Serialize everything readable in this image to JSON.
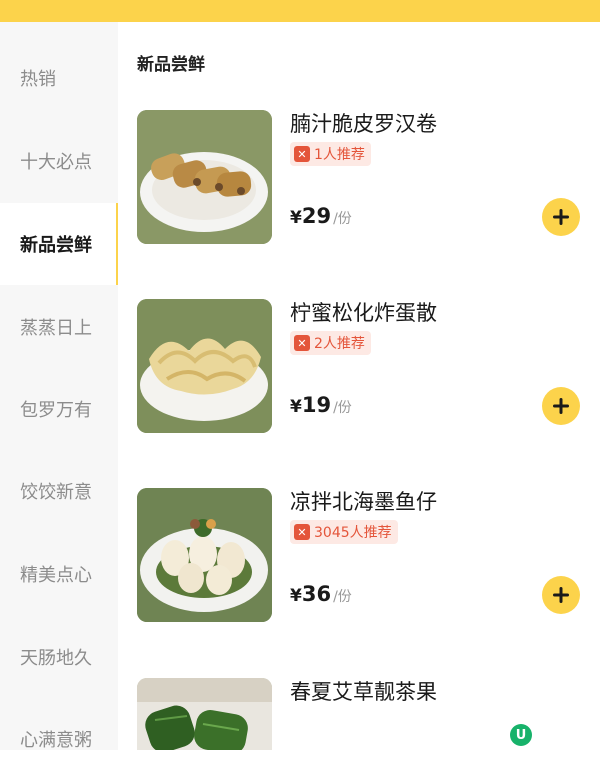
{
  "sidebar": {
    "categories": [
      {
        "label": "热销"
      },
      {
        "label": "十大必点"
      },
      {
        "label": "新品尝鲜"
      },
      {
        "label": "蒸蒸日上"
      },
      {
        "label": "包罗万有"
      },
      {
        "label": "饺饺新意"
      },
      {
        "label": "精美点心"
      },
      {
        "label": "天肠地久"
      },
      {
        "label": "心满意粥"
      }
    ],
    "active_index": 2
  },
  "section": {
    "title": "新品尝鲜"
  },
  "items": [
    {
      "name": "腩汁脆皮罗汉卷",
      "recommend": "1人推荐",
      "currency": "¥",
      "price": "29",
      "unit": "/份"
    },
    {
      "name": "柠蜜松化炸蛋散",
      "recommend": "2人推荐",
      "currency": "¥",
      "price": "19",
      "unit": "/份"
    },
    {
      "name": "凉拌北海墨鱼仔",
      "recommend": "3045人推荐",
      "currency": "¥",
      "price": "36",
      "unit": "/份"
    },
    {
      "name": "春夏艾草靓茶果"
    }
  ],
  "colors": {
    "accent": "#fcd34b",
    "recommend_text": "#e4553a",
    "recommend_bg": "#fde9e4"
  }
}
